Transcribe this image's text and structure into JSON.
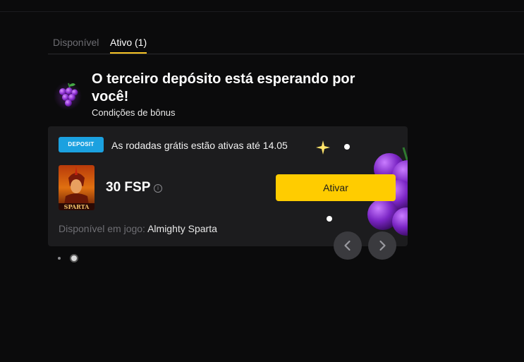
{
  "tabs": [
    {
      "label": "Disponível",
      "active": false
    },
    {
      "label": "Ativo (1)",
      "active": true
    }
  ],
  "bonus": {
    "title": "O terceiro depósito está esperando por você!",
    "conditions_link": "Condições de bônus",
    "icon": "grapes-icon"
  },
  "card": {
    "badge": "DEPOSIT",
    "text": "As rodadas grátis estão ativas até 14.05",
    "amount": "30 FSP",
    "info_icon": "info-icon",
    "activate_label": "Ativar",
    "available_label": "Disponível em jogo:",
    "game_name": "Almighty Sparta",
    "thumb_label": "SPARTA"
  },
  "colors": {
    "accent": "#ffcc00",
    "badge": "#1ba1e0",
    "card_bg": "#1c1c1e",
    "page_bg": "#0b0b0c"
  },
  "pagination": {
    "count": 2,
    "active_index": 1
  }
}
